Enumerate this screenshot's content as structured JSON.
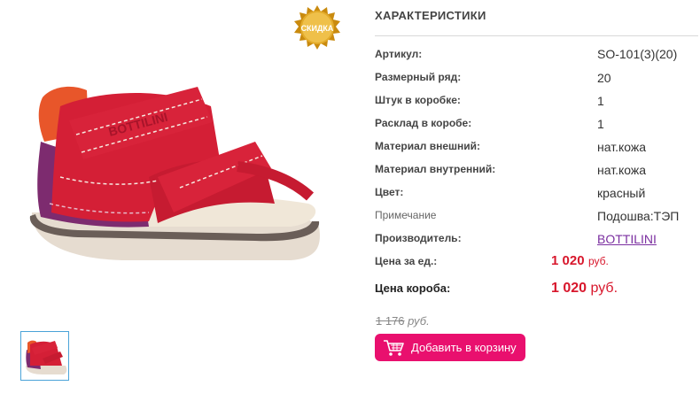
{
  "badge": {
    "label": "СКИДКА"
  },
  "product": {
    "brand_print": "BOTTILINI"
  },
  "specs": {
    "title": "ХАРАКТЕРИСТИКИ",
    "rows": [
      {
        "label": "Артикул:",
        "value": "SO-101(3)(20)"
      },
      {
        "label": "Размерный ряд:",
        "value": "20"
      },
      {
        "label": "Штук в коробке:",
        "value": "1"
      },
      {
        "label": "Расклад в коробе:",
        "value": "1"
      },
      {
        "label": "Материал внешний:",
        "value": "нат.кожа"
      },
      {
        "label": "Материал внутренний:",
        "value": "нат.кожа"
      },
      {
        "label": "Цвет:",
        "value": "красный"
      },
      {
        "label": "Примечание",
        "value": "Подошва:ТЭП"
      },
      {
        "label": "Производитель:",
        "value": "BOTTILINI"
      }
    ]
  },
  "pricing": {
    "unit_label": "Цена за ед.:",
    "unit_value": "1 020",
    "unit_currency": "руб.",
    "box_label": "Цена короба:",
    "box_value": "1 020",
    "box_currency": "руб.",
    "old_value": "1 176",
    "old_currency": "руб."
  },
  "cart": {
    "button_label": "Добавить в корзину"
  },
  "colors": {
    "accent": "#e9106e",
    "price": "#d8172c",
    "link": "#7b2fa0",
    "badge": "#d9a019"
  }
}
